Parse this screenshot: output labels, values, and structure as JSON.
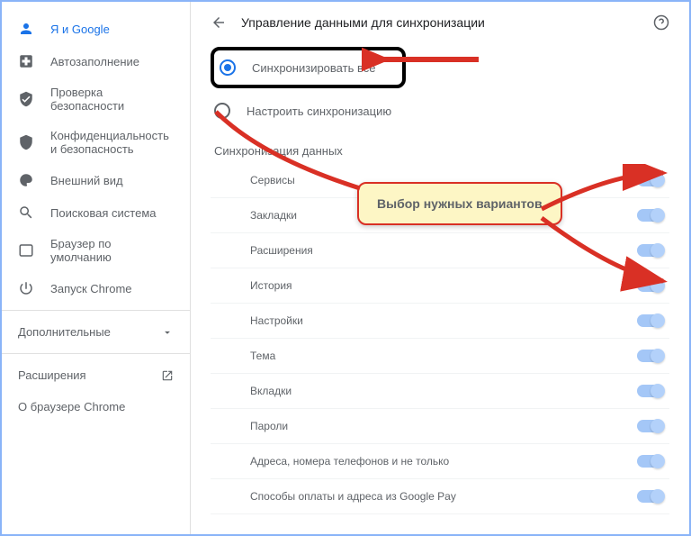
{
  "sidebar": {
    "items": [
      {
        "label": "Я и Google"
      },
      {
        "label": "Автозаполнение"
      },
      {
        "label": "Проверка безопасности"
      },
      {
        "label": "Конфиденциальность и безопасность"
      },
      {
        "label": "Внешний вид"
      },
      {
        "label": "Поисковая система"
      },
      {
        "label": "Браузер по умолчанию"
      },
      {
        "label": "Запуск Chrome"
      }
    ],
    "additional": "Дополнительные",
    "extensions": "Расширения",
    "about": "О браузере Chrome"
  },
  "header": {
    "title": "Управление данными для синхронизации"
  },
  "radios": {
    "sync_all": "Синхронизировать все",
    "customize": "Настроить синхронизацию"
  },
  "section": "Синхронизация данных",
  "sync_items": [
    {
      "label": "Сервисы"
    },
    {
      "label": "Закладки"
    },
    {
      "label": "Расширения"
    },
    {
      "label": "История"
    },
    {
      "label": "Настройки"
    },
    {
      "label": "Тема"
    },
    {
      "label": "Вкладки"
    },
    {
      "label": "Пароли"
    },
    {
      "label": "Адреса, номера телефонов и не только"
    },
    {
      "label": "Способы оплаты и адреса из Google Pay"
    }
  ],
  "callout": "Выбор нужных вариантов"
}
